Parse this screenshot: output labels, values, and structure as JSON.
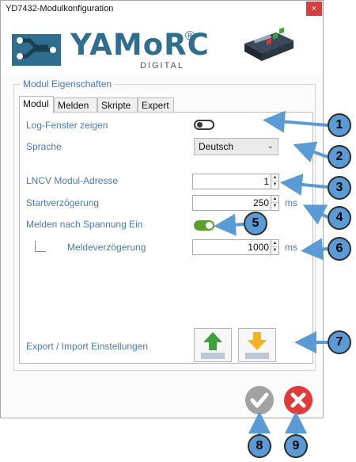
{
  "window": {
    "title": "YD7432-Modulkonfiguration",
    "close_glyph": "×"
  },
  "header": {
    "logo_text": "YAMoRC",
    "logo_reg": "®",
    "logo_sub": "DIGITAL"
  },
  "group": {
    "legend": "Modul Eigenschaften"
  },
  "tabs": [
    {
      "label": "Modul",
      "active": true
    },
    {
      "label": "Melden",
      "active": false
    },
    {
      "label": "Skripte",
      "active": false
    },
    {
      "label": "Expert",
      "active": false
    }
  ],
  "settings": {
    "log_window": {
      "label": "Log-Fenster zeigen",
      "enabled": false
    },
    "language": {
      "label": "Sprache",
      "value": "Deutsch"
    },
    "lncv_address": {
      "label": "LNCV Modul-Adresse",
      "value": "1"
    },
    "start_delay": {
      "label": "Startverzögerung",
      "value": "250",
      "unit": "ms"
    },
    "report_on_power": {
      "label": "Melden nach Spannung Ein",
      "enabled": true
    },
    "report_delay": {
      "label": "Meldeverzögerung",
      "value": "1000",
      "unit": "ms"
    },
    "export_import": {
      "label": "Export / Import Einstellungen"
    }
  },
  "icons": {
    "toggle_off": "toggle-off-icon",
    "toggle_on": "toggle-on-icon",
    "export": "upload-arrow-icon",
    "import": "download-arrow-icon",
    "ok": "checkmark-icon",
    "cancel": "x-close-icon",
    "chevron": "chevron-down-icon"
  },
  "callouts": [
    "1",
    "2",
    "3",
    "4",
    "5",
    "6",
    "7",
    "8",
    "9"
  ],
  "colors": {
    "accent_blue": "#4a7ab5",
    "callout_blue": "#5b9bd5",
    "toggle_green": "#5aa02c",
    "close_red": "#d44040",
    "cancel_red": "#e03a3a",
    "ok_gray": "#a2a2a2",
    "export_green": "#3aa43a",
    "import_yellow": "#f2b423"
  }
}
